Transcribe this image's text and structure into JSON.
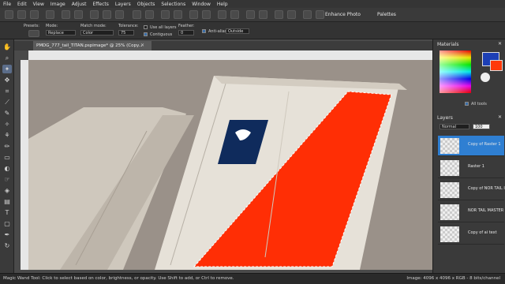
{
  "menu": [
    "File",
    "Edit",
    "View",
    "Image",
    "Adjust",
    "Effects",
    "Layers",
    "Objects",
    "Selections",
    "Window",
    "Help"
  ],
  "toolbar": {
    "enhance_photo": "Enhance Photo",
    "palettes": "Palettes"
  },
  "options": {
    "presets_label": "Presets:",
    "mode_label": "Mode:",
    "mode_value": "Replace",
    "match_mode_label": "Match mode:",
    "match_mode_value": "Color",
    "tolerance_label": "Tolerance:",
    "tolerance_value": "75",
    "use_all_layers": "Use all layers",
    "contiguous": "Contiguous",
    "feather_label": "Feather:",
    "feather_value": "0",
    "antialias": "Anti-alias",
    "antialias_value": "Outside"
  },
  "document": {
    "tab_title": "PMDG_777_tail_TITAN.pspimage* @ 25% (Copy..."
  },
  "materials": {
    "title": "Materials",
    "all_tools": "All tools",
    "fg_color": "#1c3fb5",
    "accent_red": "#ff3a0a"
  },
  "layers": {
    "title": "Layers",
    "blend_mode": "Normal",
    "opacity": "100",
    "items": [
      {
        "name": "Copy of Raster 1"
      },
      {
        "name": "Raster 1"
      },
      {
        "name": "Copy of NOR TAIL I"
      },
      {
        "name": "NOR TAIL MASTER"
      },
      {
        "name": "Copy of ai text"
      }
    ]
  },
  "status": {
    "hint": "Magic Wand Tool: Click to select based on color, brightness, or opacity. Use Shift to add, or Ctrl to remove.",
    "image_info": "Image: 4096 x 4096 x RGB - 8 bits/channel"
  }
}
